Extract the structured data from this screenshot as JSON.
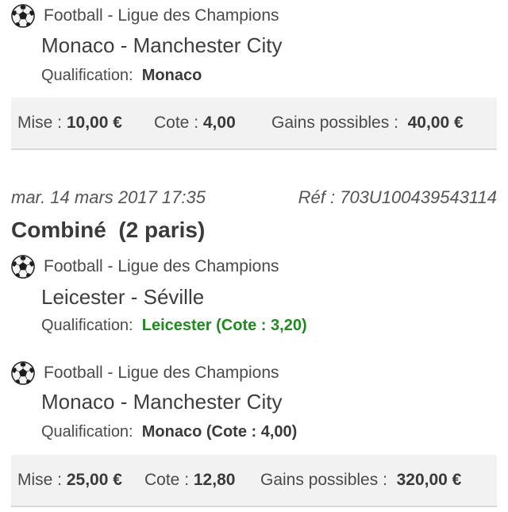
{
  "bet1": {
    "sport": "Football - Ligue des Champions",
    "match": "Monaco - Manchester City",
    "qual_label": "Qualification:",
    "qual_value": "Monaco",
    "summary": {
      "mise_label": "Mise :",
      "mise_value": "10,00 €",
      "cote_label": "Cote :",
      "cote_value": "4,00",
      "gains_label": "Gains possibles :",
      "gains_value": "40,00 €"
    }
  },
  "bet2": {
    "date": "mar. 14 mars 2017 17:35",
    "ref": "Réf : 703U100439543114",
    "title": "Combiné  (2 paris)",
    "legs": [
      {
        "sport": "Football - Ligue des Champions",
        "match": "Leicester - Séville",
        "qual_label": "Qualification:",
        "qual_value": "Leicester (Cote : 3,20)",
        "qual_color": "#1f8a1f"
      },
      {
        "sport": "Football - Ligue des Champions",
        "match": "Monaco - Manchester City",
        "qual_label": "Qualification:",
        "qual_value": "Monaco (Cote : 4,00)"
      }
    ],
    "summary": {
      "mise_label": "Mise :",
      "mise_value": "25,00 €",
      "cote_label": "Cote :",
      "cote_value": "12,80",
      "gains_label": "Gains possibles :",
      "gains_value": "320,00 €"
    }
  },
  "icons": {
    "sport": "soccer-ball-icon"
  }
}
